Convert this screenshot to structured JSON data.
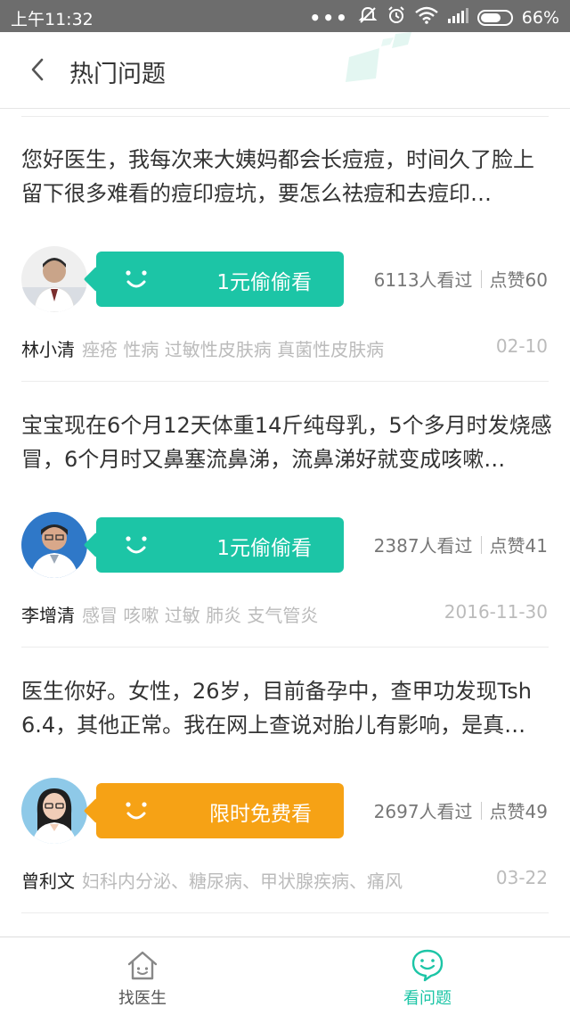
{
  "status_bar": {
    "time": "上午11:32",
    "battery": "66%",
    "dots": "•••"
  },
  "header": {
    "title": "热门问题"
  },
  "colors": {
    "green": "#1cc5a6",
    "orange": "#f6a215",
    "text_dark": "#333333",
    "text_grey": "#777777",
    "text_light": "#bbbbbb"
  },
  "questions": [
    {
      "question": "您好医生，我每次来大姨妈都会长痘痘，时间久了脸上留下很多难看的痘印痘坑，要怎么祛痘和去痘印…",
      "button_label": "1元偷偷看",
      "button_color": "green",
      "views": "6113人看过",
      "likes": "点赞60",
      "doctor": "林小清",
      "tags": "痤疮 性病 过敏性皮肤病 真菌性皮肤病",
      "date": "02-10"
    },
    {
      "question": "宝宝现在6个月12天体重14斤纯母乳，5个多月时发烧感冒，6个月时又鼻塞流鼻涕，流鼻涕好就变成咳嗽…",
      "button_label": "1元偷偷看",
      "button_color": "green",
      "views": "2387人看过",
      "likes": "点赞41",
      "doctor": "李增清",
      "tags": "感冒 咳嗽 过敏 肺炎 支气管炎",
      "date": "2016-11-30"
    },
    {
      "question": "医生你好。女性，26岁，目前备孕中，查甲功发现Tsh 6.4，其他正常。我在网上查说对胎儿有影响，是真…",
      "button_label": "限时免费看",
      "button_color": "orange",
      "views": "2697人看过",
      "likes": "点赞49",
      "doctor": "曾利文",
      "tags": "妇科内分泌、糖尿病、甲状腺疾病、痛风",
      "date": "03-22"
    }
  ],
  "bottom_nav": {
    "find_doctor": "找医生",
    "view_questions": "看问题"
  }
}
